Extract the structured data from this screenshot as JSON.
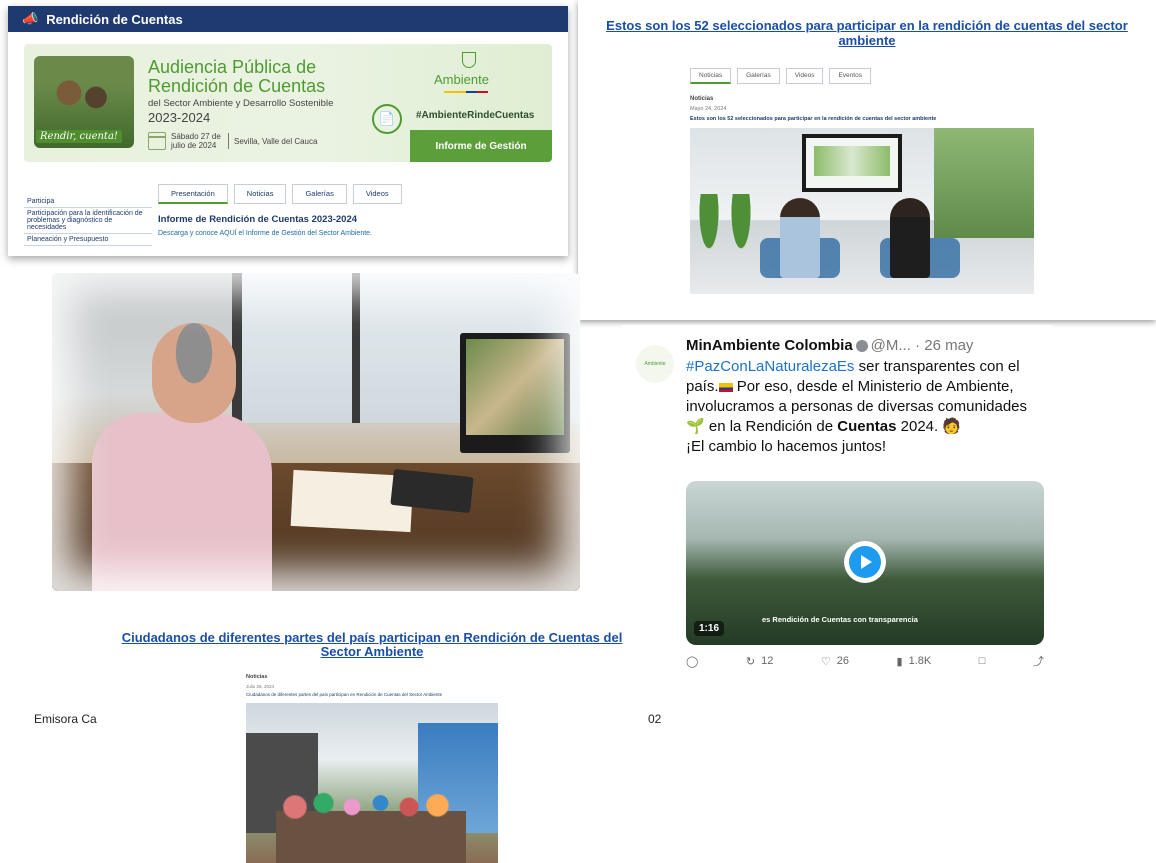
{
  "panel1": {
    "site_title": "Rendición de Cuentas",
    "hero": {
      "title": "Audiencia Pública de Rendición de Cuentas",
      "subtitle": "del Sector Ambiente y Desarrollo Sostenible",
      "years": "2023-2024",
      "date": "Sábado 27 de julio de 2024",
      "location": "Sevilla, Valle del Cauca",
      "brand": "Ambiente",
      "hashtag": "#AmbienteRindeCuentas",
      "cta": "Informe de Gestión",
      "photo_tag": "Rendir, cuenta!"
    },
    "tabs": [
      "Presentación",
      "Noticias",
      "Galerías",
      "Videos"
    ],
    "side_menu": [
      "Participa",
      "Participación para la identificación de problemas y diagnóstico de necesidades",
      "Planeación y Presupuesto"
    ],
    "content_title": "Informe de Rendición de Cuentas 2023-2024",
    "content_desc": "Descarga y conoce AQUÍ el Informe de Gestión del Sector Ambiente."
  },
  "panel2": {
    "headline": "Estos son los 52 seleccionados para participar en la rendición de cuentas del sector ambiente",
    "tabs": [
      "Noticias",
      "Galerías",
      "Videos",
      "Eventos"
    ],
    "section": "Noticias",
    "date": "Mayo 24, 2024",
    "article_title": "Estos son los 52 seleccionados para participar en la rendición de cuentas del sector ambiente"
  },
  "tweet": {
    "avatar_label": "Ambiente",
    "author": "MinAmbiente Colombia",
    "handle": "@M...",
    "time": "· 26 may",
    "hashtag": "#PazConLaNaturalezaEs",
    "text_1": " ser transparentes con el país.",
    "text_2": " Por eso, desde el Ministerio de Ambiente, involucramos a personas de diversas comunidades ",
    "text_3": " en la Rendición de ",
    "text_bold": "Cuentas",
    "text_4": " 2024.",
    "line2": "¡El cambio lo hacemos juntos!",
    "video_caption": "es Rendición de Cuentas con transparencia",
    "video_duration": "1:16",
    "retweets": "12",
    "likes": "26",
    "views": "1.8K"
  },
  "bottom_article": {
    "headline": "Ciudadanos de diferentes partes del país participan en Rendición de Cuentas del Sector Ambiente",
    "section": "Noticias",
    "date": "Julio 26, 2024",
    "article_title": "Ciudadanos de diferentes partes del país participan en Rendición de Cuentas del Sector Ambiente"
  },
  "footer": {
    "left_label": "Emisora Ca",
    "page_number": "02"
  },
  "colors": {
    "brand_green": "#4f9b31",
    "nav_blue": "#1f3a6e",
    "link_blue": "#1a4ea8",
    "twitter_blue": "#1d9bf0"
  }
}
